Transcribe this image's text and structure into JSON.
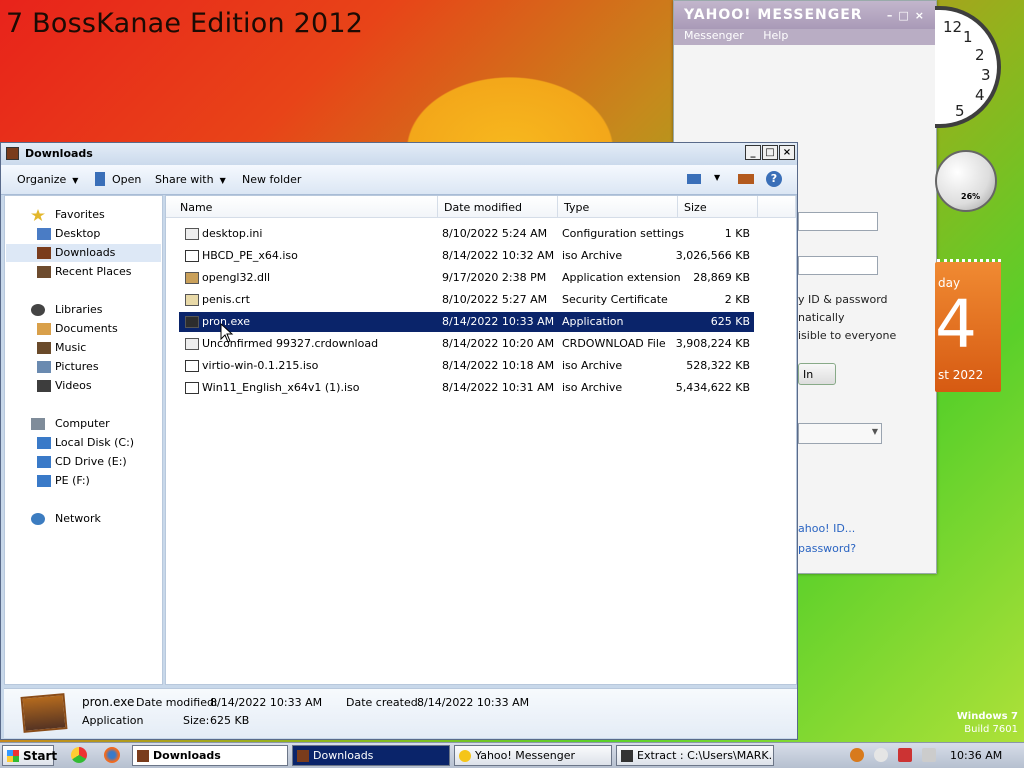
{
  "desktop": {
    "title": "7 BossKanae Edition 2012",
    "watermark_line1": "Windows 7",
    "watermark_line2": "Build 7601"
  },
  "yahoo": {
    "title": "YAHOO! MESSENGER",
    "menu": [
      "Messenger",
      "Help"
    ],
    "text1": "y ID & password",
    "text2": "natically",
    "text3": "isible to everyone",
    "signin_label": "In",
    "link1": "ahoo! ID...",
    "link2": "password?"
  },
  "gadgets": {
    "clock_numbers": [
      "12",
      "1",
      "2",
      "3",
      "4",
      "5"
    ],
    "cpu_percent": "26%",
    "calendar_day": "day",
    "calendar_num": "4",
    "calendar_month": "st 2022"
  },
  "explorer": {
    "title": "Downloads",
    "toolbar": {
      "organize": "Organize",
      "open": "Open",
      "share_with": "Share with",
      "new_folder": "New folder"
    },
    "nav": {
      "favorites": "Favorites",
      "desktop": "Desktop",
      "downloads": "Downloads",
      "recent_places": "Recent Places",
      "libraries": "Libraries",
      "documents": "Documents",
      "music": "Music",
      "pictures": "Pictures",
      "videos": "Videos",
      "computer": "Computer",
      "local_disk": "Local Disk (C:)",
      "cd_drive": "CD Drive (E:)",
      "pe": "PE (F:)",
      "network": "Network"
    },
    "columns": {
      "name": "Name",
      "date_modified": "Date modified",
      "type": "Type",
      "size": "Size"
    },
    "files": [
      {
        "name": "desktop.ini",
        "date": "8/10/2022 5:24 AM",
        "type": "Configuration settings",
        "size": "1 KB"
      },
      {
        "name": "HBCD_PE_x64.iso",
        "date": "8/14/2022 10:32 AM",
        "type": "iso Archive",
        "size": "3,026,566 KB"
      },
      {
        "name": "opengl32.dll",
        "date": "9/17/2020 2:38 PM",
        "type": "Application extension",
        "size": "28,869 KB"
      },
      {
        "name": "penis.crt",
        "date": "8/10/2022 5:27 AM",
        "type": "Security Certificate",
        "size": "2 KB"
      },
      {
        "name": "pron.exe",
        "date": "8/14/2022 10:33 AM",
        "type": "Application",
        "size": "625 KB"
      },
      {
        "name": "Unconfirmed 99327.crdownload",
        "date": "8/14/2022 10:20 AM",
        "type": "CRDOWNLOAD File",
        "size": "3,908,224 KB"
      },
      {
        "name": "virtio-win-0.1.215.iso",
        "date": "8/14/2022 10:18 AM",
        "type": "iso Archive",
        "size": "528,322 KB"
      },
      {
        "name": "Win11_English_x64v1 (1).iso",
        "date": "8/14/2022 10:31 AM",
        "type": "iso Archive",
        "size": "5,434,622 KB"
      }
    ],
    "details": {
      "name": "pron.exe",
      "date_modified_label": "Date modified:",
      "date_modified": "8/14/2022 10:33 AM",
      "date_created_label": "Date created:",
      "date_created": "8/14/2022 10:33 AM",
      "type": "Application",
      "size_label": "Size:",
      "size": "625 KB"
    }
  },
  "taskbar": {
    "start": "Start",
    "tasks": [
      "Downloads",
      "Downloads",
      "Yahoo! Messenger",
      "Extract : C:\\Users\\MARK..."
    ],
    "time": "10:36 AM"
  }
}
